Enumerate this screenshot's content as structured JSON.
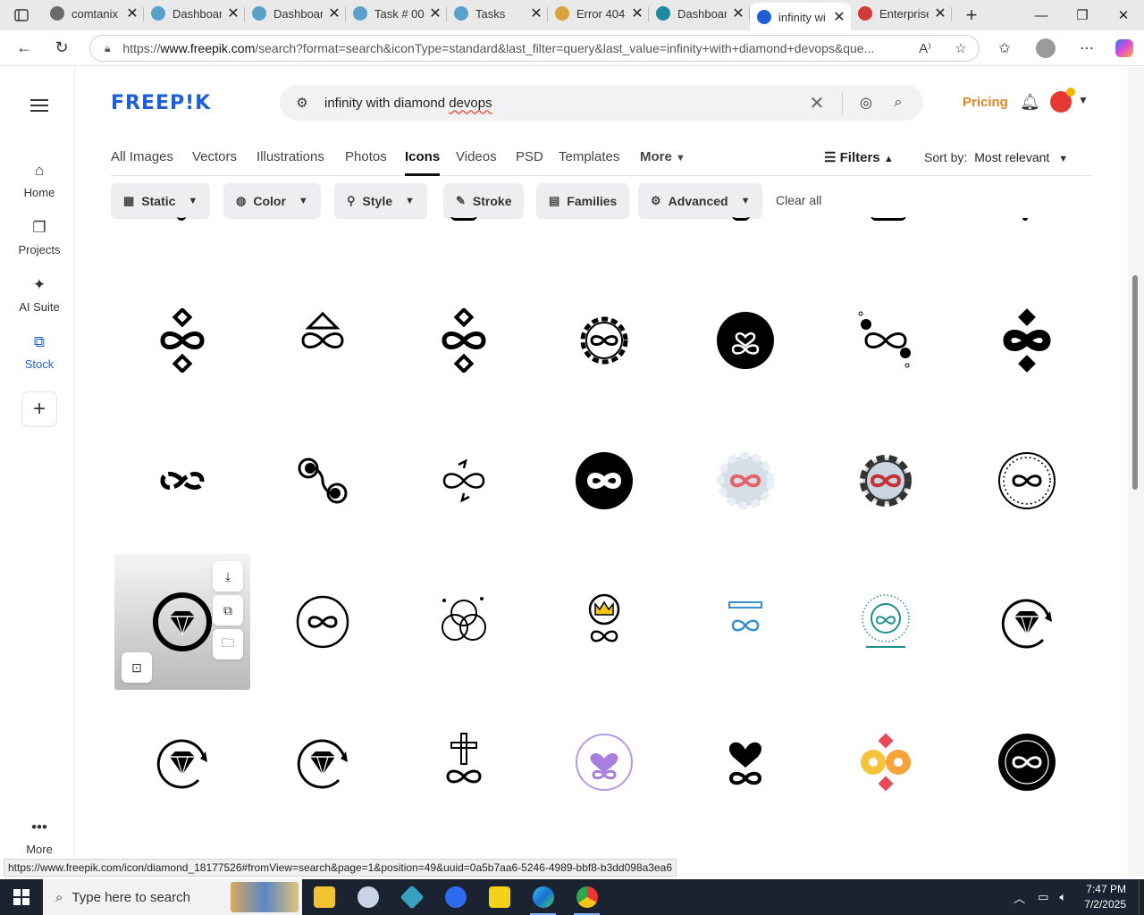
{
  "browser": {
    "tabs": [
      {
        "title": "comtanix",
        "color": "#6b6b6b"
      },
      {
        "title": "Dashboard",
        "color": "#5aa0c8"
      },
      {
        "title": "Dashboard",
        "color": "#5aa0c8"
      },
      {
        "title": "Task # 00",
        "color": "#5aa0c8"
      },
      {
        "title": "Tasks",
        "color": "#5aa0c8"
      },
      {
        "title": "Error 404",
        "color": "#d6a33b"
      },
      {
        "title": "Dashboard",
        "color": "#1e8aa0"
      },
      {
        "title": "infinity wi",
        "color": "#1f5fd6"
      },
      {
        "title": "Enterprise",
        "color": "#d33b3b"
      }
    ],
    "url_prefix": "https://",
    "url_domain": "www.freepik.com",
    "url_rest": "/search?format=search&iconType=standard&last_filter=query&last_value=infinity+with+diamond+devops&que...",
    "status_url": "https://www.freepik.com/icon/diamond_18177526#fromView=search&page=1&position=49&uuid=0a5b7aa6-5246-4989-bbf8-b3dd098a3ea6"
  },
  "sidebar": {
    "items": [
      {
        "label": "Home",
        "icon": "home-icon",
        "glyph": "⌂"
      },
      {
        "label": "Projects",
        "icon": "projects-icon",
        "glyph": "❐"
      },
      {
        "label": "AI Suite",
        "icon": "ai-suite-icon",
        "glyph": "✦"
      },
      {
        "label": "Stock",
        "icon": "stock-icon",
        "glyph": "⧉"
      }
    ],
    "more_label": "More"
  },
  "header": {
    "logo": "FREEP!K",
    "search_query_1": "infinity with diamond ",
    "search_query_2": "devops",
    "pricing": "Pricing"
  },
  "categories": [
    "All Images",
    "Vectors",
    "Illustrations",
    "Photos",
    "Icons",
    "Videos",
    "PSD",
    "Templates",
    "More"
  ],
  "active_category": "Icons",
  "filters_label": "Filters",
  "sort_label": "Sort by:",
  "sort_value": "Most relevant",
  "filter_pills": [
    {
      "label": "Static",
      "icon": "static-icon"
    },
    {
      "label": "Color",
      "icon": "color-icon"
    },
    {
      "label": "Style",
      "icon": "style-icon"
    },
    {
      "label": "Stroke",
      "icon": "stroke-icon"
    },
    {
      "label": "Families",
      "icon": "families-icon"
    },
    {
      "label": "Advanced",
      "icon": "advanced-icon"
    }
  ],
  "clear_all": "Clear all",
  "results": [
    [
      "infinity-diamond-outline",
      "infinity-triangle",
      "infinity-diamond-outline",
      "gear-infinity",
      "heart-infinity-circle",
      "infinity-dollar",
      "infinity-diamond-solid"
    ],
    [
      "infinity-broken",
      "infinity-gears",
      "infinity-arrows",
      "infinity-circle-solid",
      "gear-infinity-red",
      "gear-infinity-red-outline",
      "infinity-stamp"
    ],
    [
      "diamond-circle",
      "infinity-circle-outline",
      "triangle-knot",
      "crown-infinity",
      "infinity-blue",
      "infinity-sunburst",
      "diamond-arrows"
    ],
    [
      "diamond-arrows",
      "diamond-arrows",
      "cross-infinity",
      "heart-infinity-purple",
      "heart-infinity-solid",
      "infinity-yellow-red",
      "infinity-stamp-solid"
    ]
  ],
  "taskbar": {
    "search_placeholder": "Type here to search",
    "time": "7:47 PM",
    "date": "7/2/2025"
  }
}
